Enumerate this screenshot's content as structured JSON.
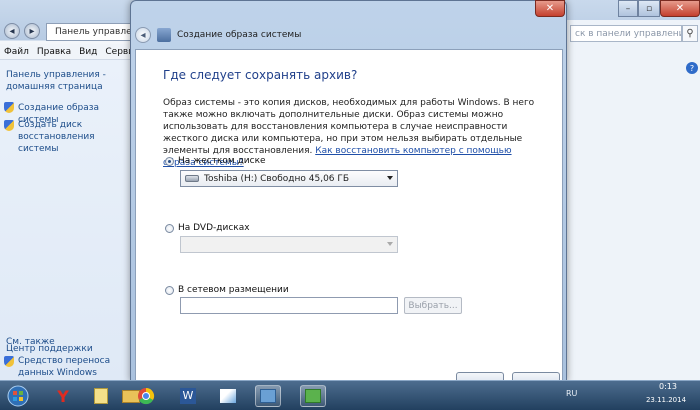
{
  "background_window": {
    "address": "Панель управле",
    "search_placeholder": "ск в панели управления",
    "menu": [
      "Файл",
      "Правка",
      "Вид",
      "Сервис"
    ],
    "sidebar": {
      "home_link": "Панель управления - домашняя страница",
      "links": [
        "Создание образа системы",
        "Создать диск восстановления системы"
      ],
      "see_also_label": "См. также",
      "see_also_links": [
        "Центр поддержки",
        "Средство переноса данных Windows"
      ]
    },
    "help_glyph": "?"
  },
  "dialog": {
    "title": "Создание образа системы",
    "question": "Где следует сохранять архив?",
    "description": "Образ системы - это копия дисков, необходимых для работы Windows. В него также можно включать дополнительные диски. Образ системы можно использовать для восстановления компьютера в случае неисправности жесткого диска или компьютера, но при этом нельзя выбирать отдельные элементы для восстановления.",
    "description_link": "Как восстановить компьютер с помощью образа системы?",
    "options": {
      "hard_disk": {
        "label": "На жестком диске",
        "selected": true,
        "value": "Toshiba (H:)  Свободно 45,06 ГБ"
      },
      "dvd": {
        "label": "На DVD-дисках",
        "selected": false,
        "value": ""
      },
      "network": {
        "label": "В сетевом размещении",
        "selected": false,
        "value": "",
        "browse_label": "Выбрать..."
      }
    }
  },
  "taskbar": {
    "items": [
      "start-orb-icon",
      "yandex-browser-icon",
      "notes-icon",
      "folder-icon",
      "chrome-icon",
      "word-icon",
      "paint-icon",
      "control-panel-icon",
      "backup-icon"
    ],
    "language": "RU",
    "time": "0:13",
    "date": "23.11.2014"
  }
}
